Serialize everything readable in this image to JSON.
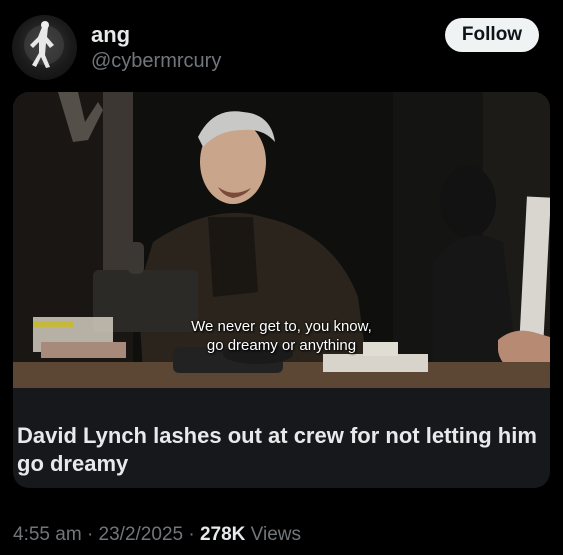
{
  "post": {
    "author_name": "ang",
    "author_handle": "@cybermrcury",
    "follow_label": "Follow"
  },
  "media": {
    "subtitle_line1": "We never get to, you know,",
    "subtitle_line2": "go dreamy or anything"
  },
  "card": {
    "title": "David Lynch lashes out at crew for not letting him go dreamy"
  },
  "meta": {
    "time": "4:55 am",
    "separator": "·",
    "date": "23/2/2025",
    "views_count": "278K",
    "views_label": "Views"
  }
}
